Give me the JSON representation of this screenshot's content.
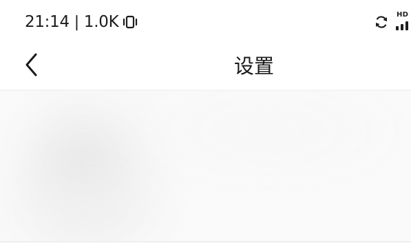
{
  "status_bar": {
    "time": "21:14",
    "separator": "|",
    "network_speed": "1.0K",
    "hd_label": "HD",
    "icons": [
      "vibrate-icon",
      "sync-icon",
      "signal-icon"
    ]
  },
  "app_bar": {
    "title": "设置",
    "back_icon": "chevron-left-icon"
  },
  "colors": {
    "background": "#ffffff",
    "content_background": "#fafafa",
    "text": "#1a1a1a"
  }
}
